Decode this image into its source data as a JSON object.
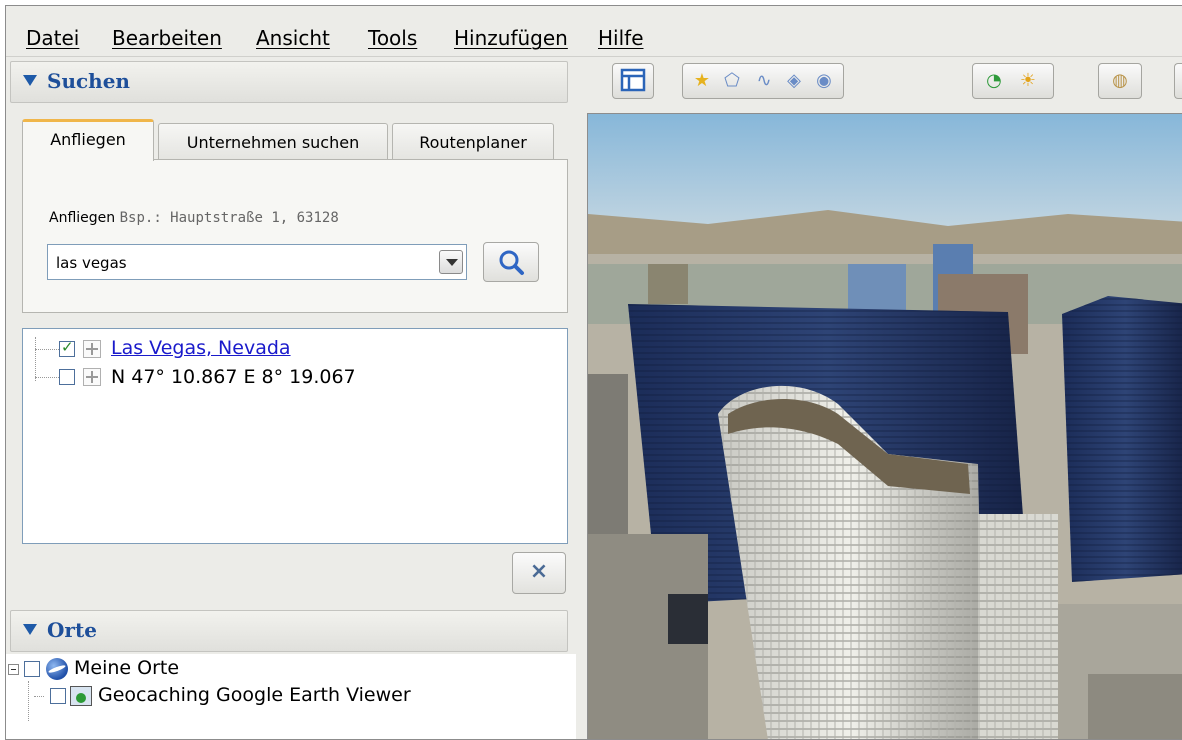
{
  "menu": {
    "items": [
      {
        "label": "Datei"
      },
      {
        "label": "Bearbeiten"
      },
      {
        "label": "Ansicht"
      },
      {
        "label": "Tools"
      },
      {
        "label": "Hinzufügen"
      },
      {
        "label": "Hilfe"
      }
    ]
  },
  "search_panel": {
    "title": "Suchen",
    "tabs": [
      {
        "label": "Anfliegen",
        "active": true
      },
      {
        "label": "Unternehmen suchen",
        "active": false
      },
      {
        "label": "Routenplaner",
        "active": false
      }
    ],
    "fly_to_label": "Anfliegen",
    "fly_to_hint": "Bsp.: Hauptstraße 1, 63128",
    "query_value": "las vegas"
  },
  "results": [
    {
      "label": "Las Vegas, Nevada",
      "checked": true,
      "is_link": true
    },
    {
      "label": "N 47° 10.867 E 8° 19.067",
      "checked": false,
      "is_link": false
    }
  ],
  "clear_label": "×",
  "places_panel": {
    "title": "Orte",
    "my_places_label": "Meine Orte",
    "child_label": "Geocaching Google Earth Viewer"
  },
  "toolbar": {
    "icons": [
      "sidebar-toggle-icon",
      "add-placemark-icon",
      "add-polygon-icon",
      "add-path-icon",
      "add-image-overlay-icon",
      "record-tour-icon",
      "historical-imagery-icon",
      "sunlight-icon",
      "switch-planet-icon"
    ]
  },
  "colors": {
    "accent": "#1e4f9a",
    "link": "#1a1acb",
    "tab_highlight": "#f0b64a"
  }
}
